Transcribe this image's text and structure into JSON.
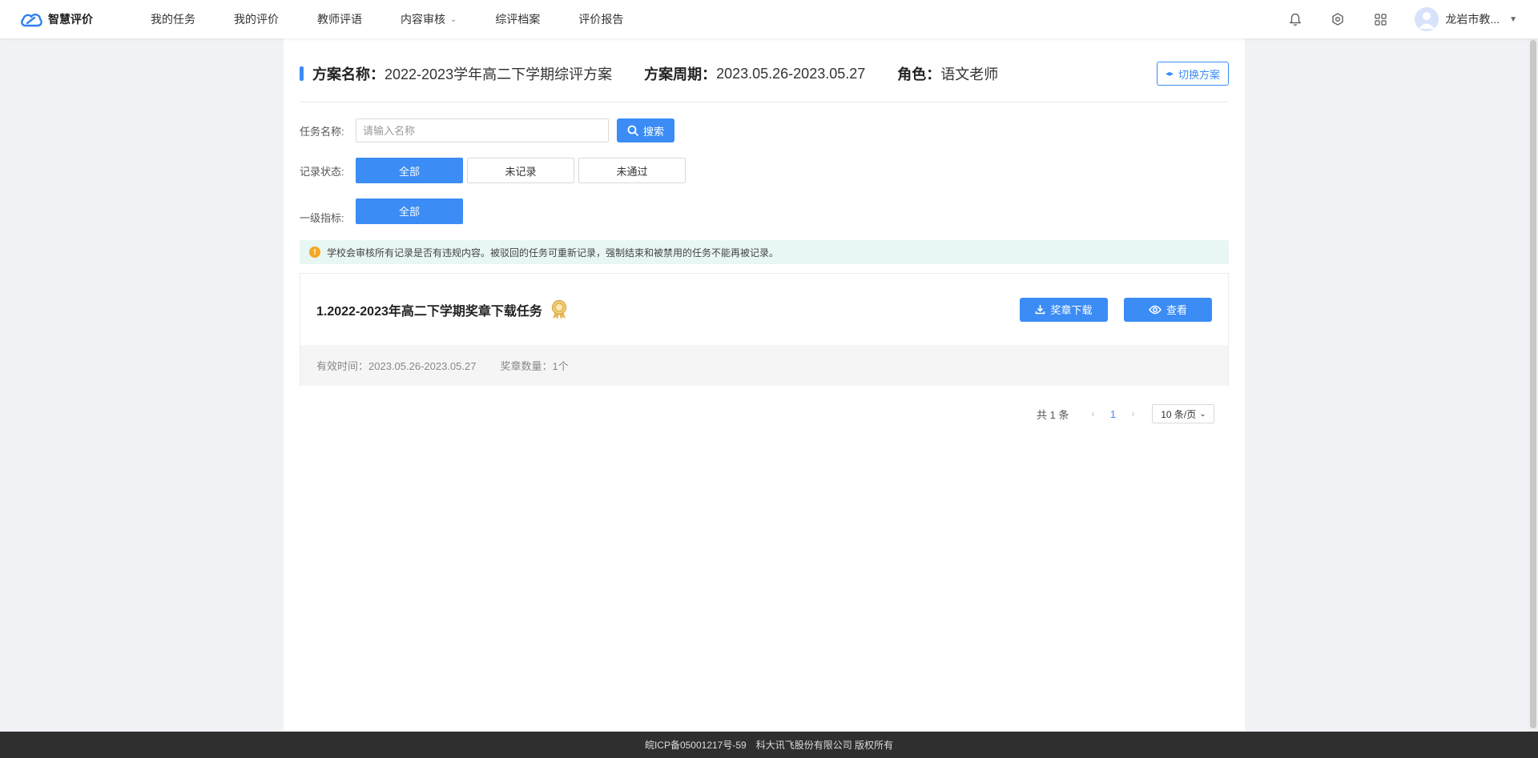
{
  "brand": {
    "name": "智慧评价",
    "icon": "cloud-logo-icon"
  },
  "nav": [
    {
      "label": "我的任务"
    },
    {
      "label": "我的评价"
    },
    {
      "label": "教师评语"
    },
    {
      "label": "内容审核",
      "has_dropdown": true
    },
    {
      "label": "综评档案"
    },
    {
      "label": "评价报告"
    }
  ],
  "topbar": {
    "user_name": "龙岩市教...",
    "icons": [
      "bell-icon",
      "gear-icon",
      "apps-grid-icon"
    ]
  },
  "scheme": {
    "name_label": "方案名称：",
    "name_value": "2022-2023学年高二下学期综评方案",
    "period_label": "方案周期：",
    "period_value": "2023.05.26-2023.05.27",
    "role_label": "角色：",
    "role_value": "语文老师",
    "switch_label": "切换方案"
  },
  "filters": {
    "task_name_label": "任务名称:",
    "task_name_placeholder": "请输入名称",
    "task_name_value": "",
    "search_label": "搜索",
    "status_label": "记录状态:",
    "status_options": [
      "全部",
      "未记录",
      "未通过"
    ],
    "status_selected": "全部",
    "indicator_label": "一级指标:",
    "indicator_options": [
      "全部"
    ],
    "indicator_selected": "全部"
  },
  "notice": "学校会审核所有记录是否有违规内容。被驳回的任务可重新记录，强制结束和被禁用的任务不能再被记录。",
  "tasks": [
    {
      "title": "1.2022-2023年高二下学期奖章下载任务",
      "download_label": "奖章下载",
      "view_label": "查看",
      "valid_time": "有效时间：2023.05.26-2023.05.27",
      "medal_count": "奖章数量：1个"
    }
  ],
  "pagination": {
    "total": "共 1 条",
    "current_page": "1",
    "page_size": "10 条/页"
  },
  "footer": {
    "icp": "皖ICP备05001217号-59",
    "copyright": "科大讯飞股份有限公司 版权所有"
  },
  "colors": {
    "primary": "#3b8cf5",
    "notice_bg": "#e8f6f4",
    "footer_bg": "#2f2f2f"
  }
}
